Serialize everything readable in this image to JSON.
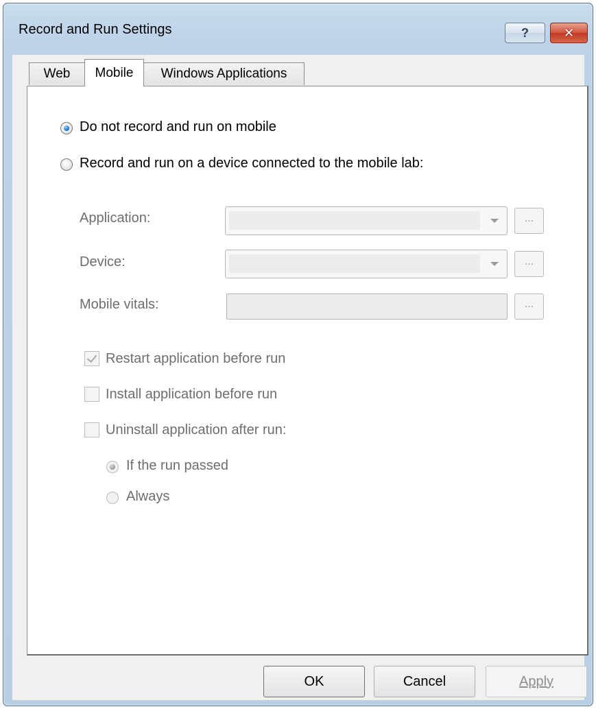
{
  "window": {
    "title": "Record and Run Settings",
    "help_label": "?",
    "close_label": "✕"
  },
  "tabs": [
    {
      "label": "Web",
      "selected": false
    },
    {
      "label": "Mobile",
      "selected": true
    },
    {
      "label": "Windows Applications",
      "selected": false
    }
  ],
  "mobile": {
    "option_no_mobile": "Do not record and run on mobile",
    "option_mobile_lab": "Record and run on a device connected to the mobile lab:",
    "selected_option": "option_no_mobile",
    "application_label": "Application:",
    "application_value": "",
    "device_label": "Device:",
    "device_value": "",
    "vitals_label": "Mobile vitals:",
    "vitals_value": "",
    "browse_label": "...",
    "restart_label": "Restart application before run",
    "restart_checked": true,
    "install_label": "Install application before run",
    "install_checked": false,
    "uninstall_label": "Uninstall application after run:",
    "uninstall_checked": false,
    "if_passed_label": "If the run passed",
    "if_passed_checked": true,
    "always_label": "Always",
    "always_checked": false
  },
  "buttons": {
    "ok": "OK",
    "cancel": "Cancel",
    "apply": "Apply"
  },
  "colors": {
    "titlebar": "#bcd2e8",
    "close_button": "#c13a22",
    "radio_selected": "#1f7ad1",
    "disabled_text": "#6d6d6d"
  }
}
